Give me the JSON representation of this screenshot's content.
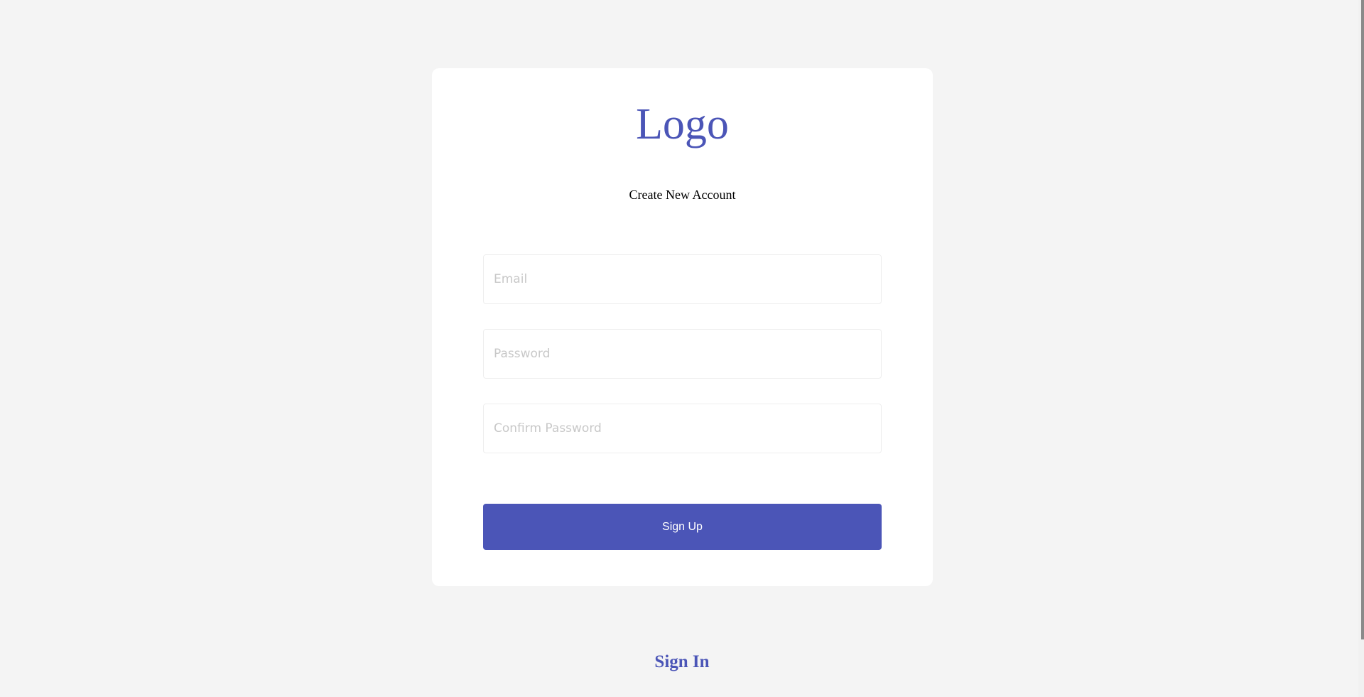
{
  "card": {
    "logo_text": "Logo",
    "heading": "Create New Account"
  },
  "form": {
    "email_placeholder": "Email",
    "password_placeholder": "Password",
    "confirm_password_placeholder": "Confirm Password",
    "submit_label": "Sign Up"
  },
  "footer": {
    "signin_label": "Sign In"
  },
  "colors": {
    "accent": "#4b55b7",
    "background": "#f4f4f4",
    "card": "#ffffff"
  }
}
